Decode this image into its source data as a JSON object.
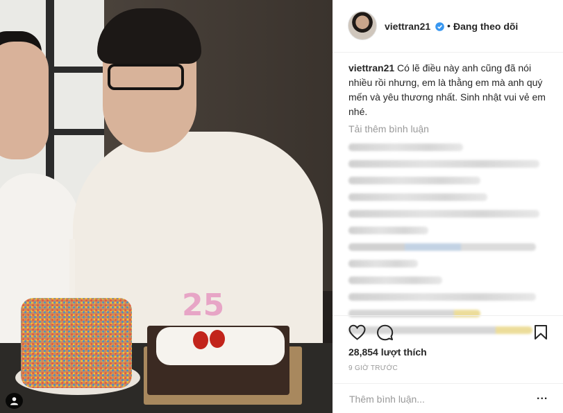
{
  "post": {
    "author": "viettran21",
    "verified_color": "#3897f0",
    "follow_separator": "•",
    "follow_status": "Đang theo dõi",
    "caption_user": "viettran21",
    "caption_text": " Có lẽ điều này anh cũng đã nói nhiều rồi nhưng, em là thằng em mà anh quý mến và yêu thương nhất. Sinh nhật vui vẻ em nhé.",
    "load_more": "Tải thêm bình luận",
    "likes": "28,854 lượt thích",
    "time": "9 GIỜ TRƯỚC",
    "comment_placeholder": "Thêm bình luận...",
    "more_options": "...",
    "photo_candle_number": "25",
    "icons": [
      "heart-icon",
      "comment-icon",
      "bookmark-icon",
      "user-tag-icon",
      "verified-badge-icon"
    ]
  }
}
